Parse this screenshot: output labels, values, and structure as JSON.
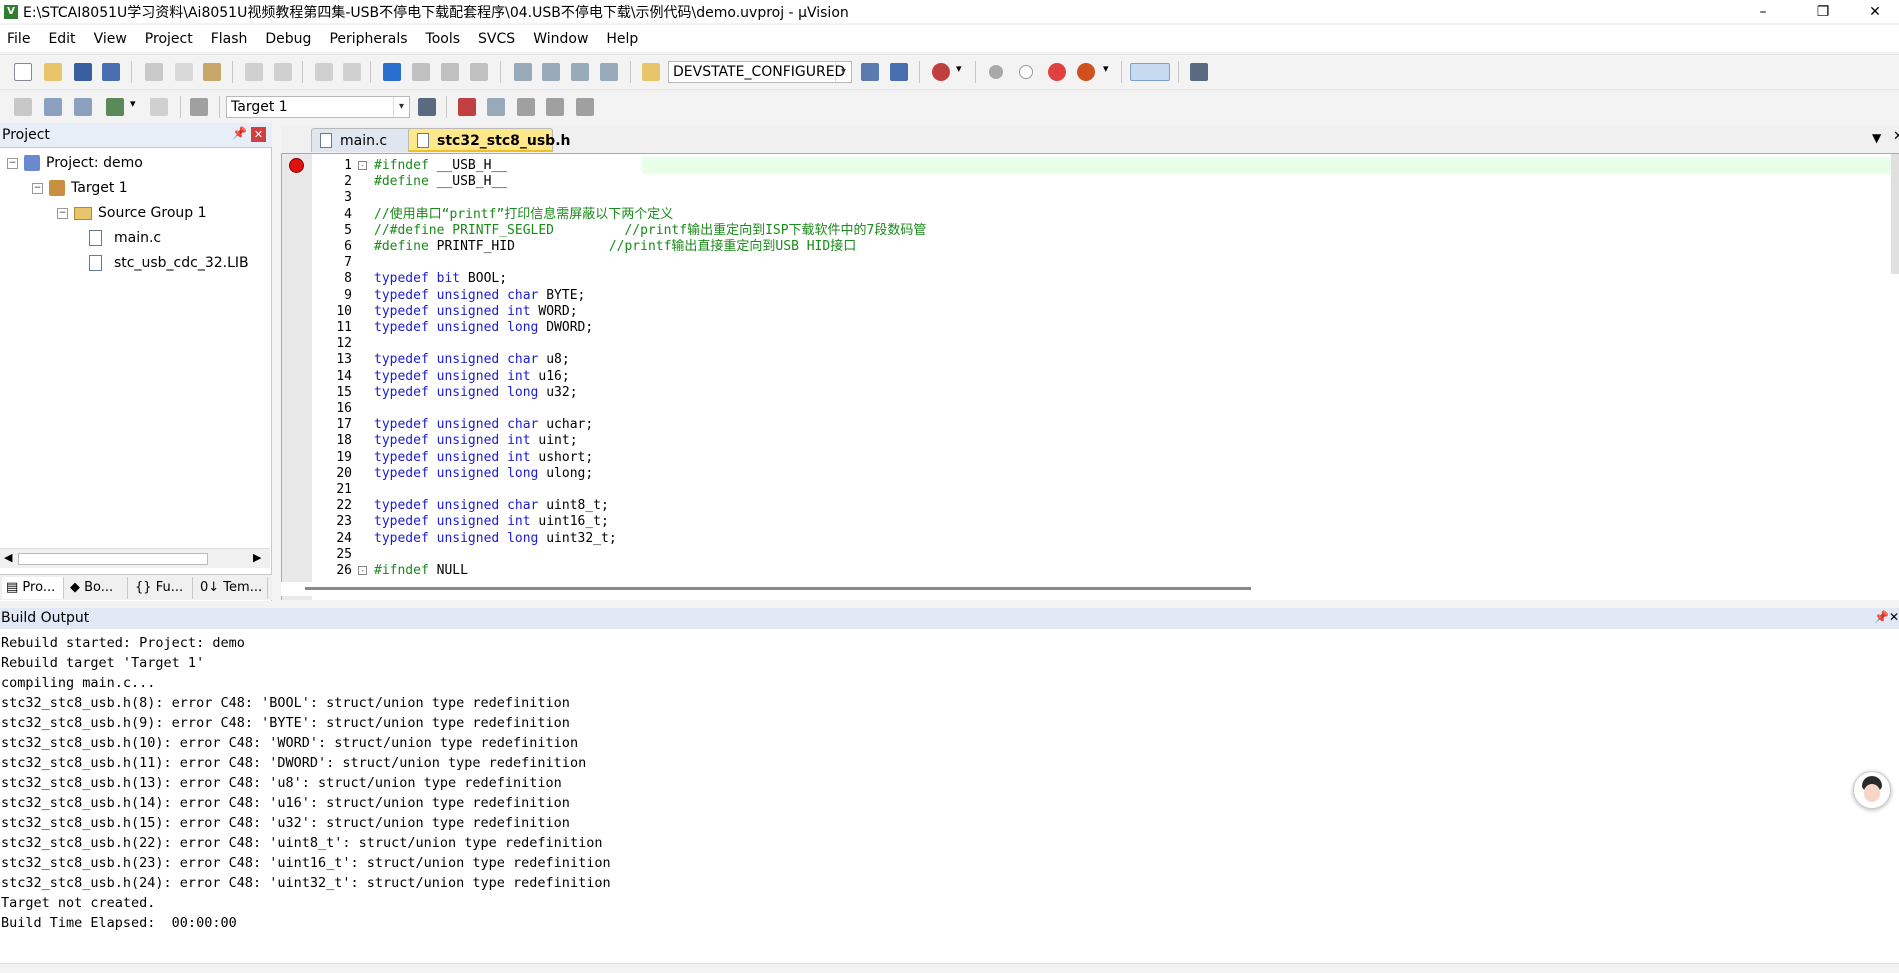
{
  "window": {
    "title": "E:\\STCAI8051U学习资料\\Ai8051U视频教程第四集-USB不停电下载配套程序\\04.USB不停电下载\\示例代码\\demo.uvproj - µVision",
    "icon": "V"
  },
  "menu": [
    "File",
    "Edit",
    "View",
    "Project",
    "Flash",
    "Debug",
    "Peripherals",
    "Tools",
    "SVCS",
    "Window",
    "Help"
  ],
  "toolbar1": {
    "devstate": "DEVSTATE_CONFIGURED"
  },
  "toolbar2": {
    "target": "Target 1"
  },
  "project": {
    "header": "Project",
    "tree": {
      "project": "Project: demo",
      "target": "Target 1",
      "group": "Source Group 1",
      "files": [
        "main.c",
        "stc_usb_cdc_32.LIB"
      ]
    },
    "tabs": [
      "Pro...",
      "Bo...",
      "Fu...",
      "Tem..."
    ]
  },
  "editor": {
    "tabs": [
      "main.c",
      "stc32_stc8_usb.h"
    ],
    "active_tab": "stc32_stc8_usb.h",
    "lines": [
      {
        "n": "1",
        "fold": "-",
        "parts": [
          [
            "pp",
            "#ifndef"
          ],
          [
            "",
            " __USB_H__"
          ]
        ]
      },
      {
        "n": "2",
        "parts": [
          [
            "pp",
            "#define"
          ],
          [
            "",
            " __USB_H__"
          ]
        ]
      },
      {
        "n": "3",
        "parts": []
      },
      {
        "n": "4",
        "parts": [
          [
            "cm",
            "//使用串口“printf”打印信息需屏蔽以下两个定义"
          ]
        ]
      },
      {
        "n": "5",
        "parts": [
          [
            "cm",
            "//#define PRINTF_SEGLED         //printf输出重定向到ISP下载软件中的7段数码管"
          ]
        ]
      },
      {
        "n": "6",
        "parts": [
          [
            "pp",
            "#define"
          ],
          [
            "",
            " PRINTF_HID            "
          ],
          [
            "cm",
            "//printf输出直接重定向到USB HID接口"
          ]
        ]
      },
      {
        "n": "7",
        "parts": []
      },
      {
        "n": "8",
        "parts": [
          [
            "kw",
            "typedef"
          ],
          [
            "",
            " "
          ],
          [
            "kw",
            "bit"
          ],
          [
            "",
            " BOOL;"
          ]
        ]
      },
      {
        "n": "9",
        "parts": [
          [
            "kw",
            "typedef"
          ],
          [
            "",
            " "
          ],
          [
            "kw",
            "unsigned"
          ],
          [
            "",
            " "
          ],
          [
            "kw",
            "char"
          ],
          [
            "",
            " BYTE;"
          ]
        ]
      },
      {
        "n": "10",
        "parts": [
          [
            "kw",
            "typedef"
          ],
          [
            "",
            " "
          ],
          [
            "kw",
            "unsigned"
          ],
          [
            "",
            " "
          ],
          [
            "kw",
            "int"
          ],
          [
            "",
            " WORD;"
          ]
        ]
      },
      {
        "n": "11",
        "parts": [
          [
            "kw",
            "typedef"
          ],
          [
            "",
            " "
          ],
          [
            "kw",
            "unsigned"
          ],
          [
            "",
            " "
          ],
          [
            "kw",
            "long"
          ],
          [
            "",
            " DWORD;"
          ]
        ]
      },
      {
        "n": "12",
        "parts": []
      },
      {
        "n": "13",
        "parts": [
          [
            "kw",
            "typedef"
          ],
          [
            "",
            " "
          ],
          [
            "kw",
            "unsigned"
          ],
          [
            "",
            " "
          ],
          [
            "kw",
            "char"
          ],
          [
            "",
            " u8;"
          ]
        ]
      },
      {
        "n": "14",
        "parts": [
          [
            "kw",
            "typedef"
          ],
          [
            "",
            " "
          ],
          [
            "kw",
            "unsigned"
          ],
          [
            "",
            " "
          ],
          [
            "kw",
            "int"
          ],
          [
            "",
            " u16;"
          ]
        ]
      },
      {
        "n": "15",
        "parts": [
          [
            "kw",
            "typedef"
          ],
          [
            "",
            " "
          ],
          [
            "kw",
            "unsigned"
          ],
          [
            "",
            " "
          ],
          [
            "kw",
            "long"
          ],
          [
            "",
            " u32;"
          ]
        ]
      },
      {
        "n": "16",
        "parts": []
      },
      {
        "n": "17",
        "parts": [
          [
            "kw",
            "typedef"
          ],
          [
            "",
            " "
          ],
          [
            "kw",
            "unsigned"
          ],
          [
            "",
            " "
          ],
          [
            "kw",
            "char"
          ],
          [
            "",
            " uchar;"
          ]
        ]
      },
      {
        "n": "18",
        "parts": [
          [
            "kw",
            "typedef"
          ],
          [
            "",
            " "
          ],
          [
            "kw",
            "unsigned"
          ],
          [
            "",
            " "
          ],
          [
            "kw",
            "int"
          ],
          [
            "",
            " uint;"
          ]
        ]
      },
      {
        "n": "19",
        "parts": [
          [
            "kw",
            "typedef"
          ],
          [
            "",
            " "
          ],
          [
            "kw",
            "unsigned"
          ],
          [
            "",
            " "
          ],
          [
            "kw",
            "int"
          ],
          [
            "",
            " ushort;"
          ]
        ]
      },
      {
        "n": "20",
        "parts": [
          [
            "kw",
            "typedef"
          ],
          [
            "",
            " "
          ],
          [
            "kw",
            "unsigned"
          ],
          [
            "",
            " "
          ],
          [
            "kw",
            "long"
          ],
          [
            "",
            " ulong;"
          ]
        ]
      },
      {
        "n": "21",
        "parts": []
      },
      {
        "n": "22",
        "parts": [
          [
            "kw",
            "typedef"
          ],
          [
            "",
            " "
          ],
          [
            "kw",
            "unsigned"
          ],
          [
            "",
            " "
          ],
          [
            "kw",
            "char"
          ],
          [
            "",
            " uint8_t;"
          ]
        ]
      },
      {
        "n": "23",
        "parts": [
          [
            "kw",
            "typedef"
          ],
          [
            "",
            " "
          ],
          [
            "kw",
            "unsigned"
          ],
          [
            "",
            " "
          ],
          [
            "kw",
            "int"
          ],
          [
            "",
            " uint16_t;"
          ]
        ]
      },
      {
        "n": "24",
        "parts": [
          [
            "kw",
            "typedef"
          ],
          [
            "",
            " "
          ],
          [
            "kw",
            "unsigned"
          ],
          [
            "",
            " "
          ],
          [
            "kw",
            "long"
          ],
          [
            "",
            " uint32_t;"
          ]
        ]
      },
      {
        "n": "25",
        "parts": []
      },
      {
        "n": "26",
        "fold": "-",
        "parts": [
          [
            "pp",
            "#ifndef"
          ],
          [
            "",
            " NULL"
          ]
        ]
      }
    ]
  },
  "build": {
    "header": "Build Output",
    "lines": [
      "Rebuild started: Project: demo",
      "Rebuild target 'Target 1'",
      "compiling main.c...",
      "stc32_stc8_usb.h(8): error C48: 'BOOL': struct/union type redefinition",
      "stc32_stc8_usb.h(9): error C48: 'BYTE': struct/union type redefinition",
      "stc32_stc8_usb.h(10): error C48: 'WORD': struct/union type redefinition",
      "stc32_stc8_usb.h(11): error C48: 'DWORD': struct/union type redefinition",
      "stc32_stc8_usb.h(13): error C48: 'u8': struct/union type redefinition",
      "stc32_stc8_usb.h(14): error C48: 'u16': struct/union type redefinition",
      "stc32_stc8_usb.h(15): error C48: 'u32': struct/union type redefinition",
      "stc32_stc8_usb.h(22): error C48: 'uint8_t': struct/union type redefinition",
      "stc32_stc8_usb.h(23): error C48: 'uint16_t': struct/union type redefinition",
      "stc32_stc8_usb.h(24): error C48: 'uint32_t': struct/union type redefinition",
      "Target not created.",
      "Build Time Elapsed:  00:00:00"
    ]
  },
  "colors": {
    "keyword": "#1b1bd6",
    "comment": "#1a8a1a",
    "active_tab": "#ffe88a",
    "panel_header": "#e8eef7",
    "breakpoint": "#e01010"
  }
}
